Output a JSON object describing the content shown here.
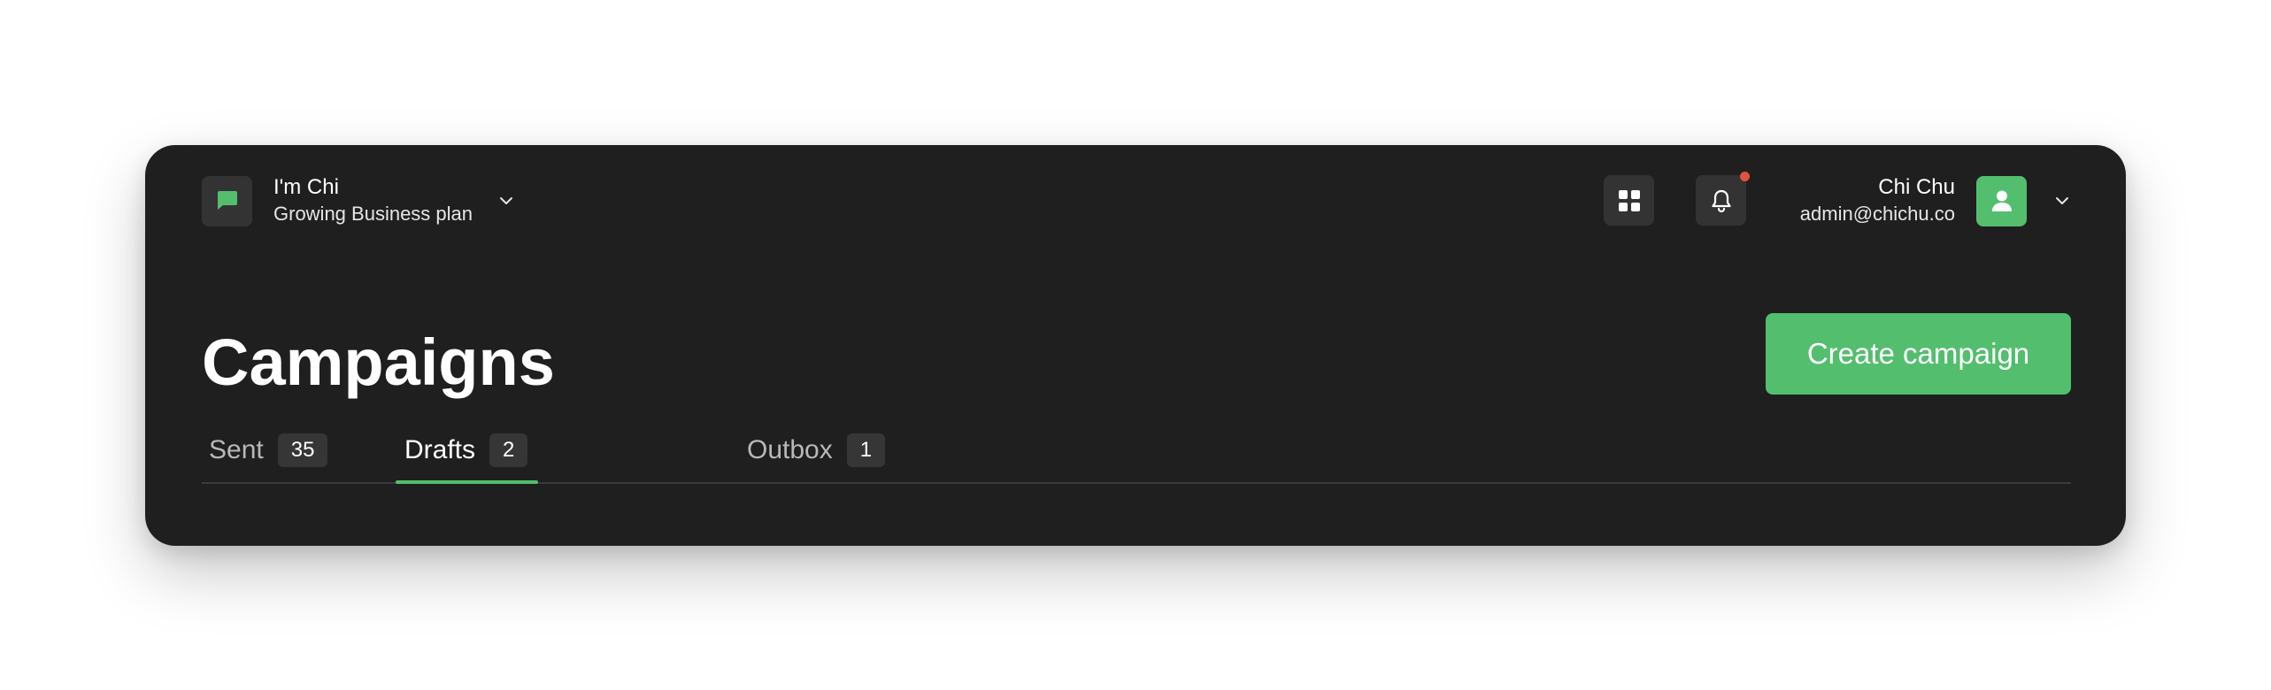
{
  "workspace": {
    "name": "I'm Chi",
    "plan": "Growing Business plan",
    "logo_icon": "chat-bubble-icon",
    "accent": "#53be6e"
  },
  "header": {
    "apps_icon": "grid-icon",
    "notifications_icon": "bell-icon",
    "notification_dot_color": "#e0533d"
  },
  "user": {
    "name": "Chi Chu",
    "email": "admin@chichu.co",
    "avatar_icon": "user-icon"
  },
  "page": {
    "title": "Campaigns",
    "create_label": "Create campaign"
  },
  "tabs": [
    {
      "label": "Sent",
      "count": "35",
      "active": false
    },
    {
      "label": "Drafts",
      "count": "2",
      "active": true
    },
    {
      "label": "Outbox",
      "count": "1",
      "active": false
    }
  ],
  "colors": {
    "card_background": "#1f1f1f",
    "accent": "#53be6e",
    "surface": "#333333"
  }
}
